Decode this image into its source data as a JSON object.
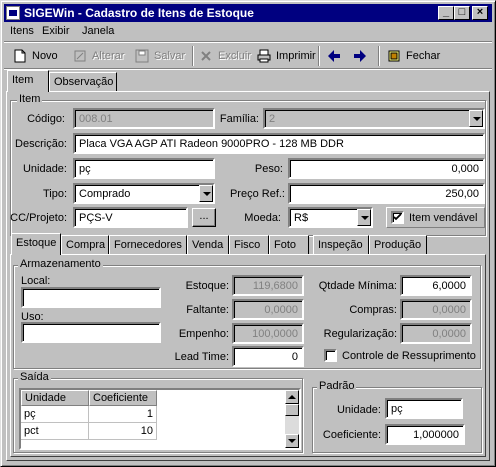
{
  "window": {
    "title": "SIGEWin - Cadastro de Itens de Estoque"
  },
  "menu": [
    "Itens",
    "Exibir",
    "Janela"
  ],
  "toolbar": {
    "novo": "Novo",
    "alterar": "Alterar",
    "salvar": "Salvar",
    "excluir": "Excluir",
    "imprimir": "Imprimir",
    "fechar": "Fechar"
  },
  "top_tabs": [
    "Item",
    "Observação"
  ],
  "item": {
    "group_label": "Item",
    "codigo_label": "Código:",
    "codigo": "008.01",
    "familia_label": "Família:",
    "familia": "2",
    "descricao_label": "Descrição:",
    "descricao": "Placa VGA AGP ATI Radeon 9000PRO - 128 MB DDR",
    "unidade_label": "Unidade:",
    "unidade": "pç",
    "peso_label": "Peso:",
    "peso": "0,000",
    "tipo_label": "Tipo:",
    "tipo": "Comprado",
    "preco_label": "Preço Ref.:",
    "preco": "250,00",
    "cc_label": "CC/Projeto:",
    "cc": "PÇS-V",
    "cc_btn": "...",
    "moeda_label": "Moeda:",
    "moeda": "R$",
    "vendavel_label": "Item vendável",
    "vendavel": true
  },
  "sub_tabs": [
    "Estoque",
    "Compra",
    "Fornecedores",
    "Venda",
    "Fisco",
    "Foto",
    "Inspeção",
    "Produção"
  ],
  "armazenamento": {
    "label": "Armazenamento",
    "local_label": "Local:",
    "local": "",
    "uso_label": "Uso:",
    "uso": "",
    "estoque_label": "Estoque:",
    "estoque": "119,6800",
    "faltante_label": "Faltante:",
    "faltante": "0,0000",
    "empenho_label": "Empenho:",
    "empenho": "100,0000",
    "leadtime_label": "Lead Time:",
    "leadtime": "0",
    "qtd_min_label": "Qtdade Mínima:",
    "qtd_min": "6,0000",
    "compras_label": "Compras:",
    "compras": "0,0000",
    "regularizacao_label": "Regularização:",
    "regularizacao": "0,0000",
    "ressuprimento_label": "Controle de Ressuprimento",
    "ressuprimento": false
  },
  "saida": {
    "label": "Saída",
    "columns": [
      "Unidade",
      "Coeficiente"
    ],
    "rows": [
      [
        "pç",
        "1"
      ],
      [
        "pct",
        "10"
      ]
    ]
  },
  "padrao": {
    "label": "Padrão",
    "unidade_label": "Unidade:",
    "unidade": "pç",
    "coef_label": "Coeficiente:",
    "coef": "1,000000"
  }
}
